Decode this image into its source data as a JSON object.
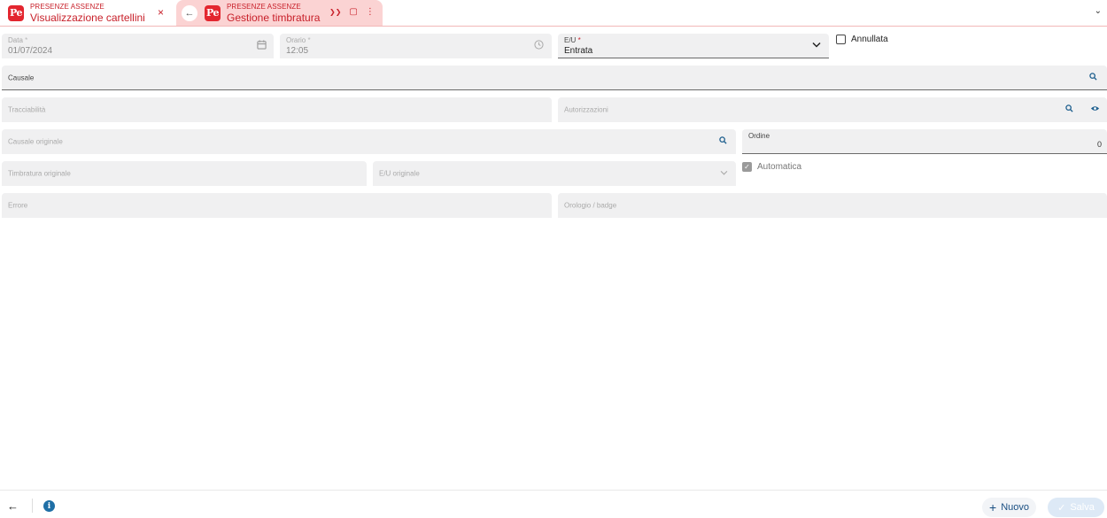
{
  "tabs": [
    {
      "app": "PRESENZE ASSENZE",
      "title": "Visualizzazione cartellini",
      "logo": "Pe",
      "close": "×"
    },
    {
      "app": "PRESENZE ASSENZE",
      "title": "Gestione timbratura",
      "logo": "Pe",
      "back": "←",
      "actions": [
        "❯❯",
        "▢",
        "⋮"
      ]
    }
  ],
  "tabbar_chevron": "⌄",
  "form": {
    "data": {
      "label": "Data",
      "required": "*",
      "value": "01/07/2024",
      "icon": "calendar-icon"
    },
    "orario": {
      "label": "Orario",
      "required": "*",
      "value": "12:05",
      "icon": "clock-icon"
    },
    "eu": {
      "label": "E/U",
      "required": "*",
      "value": "Entrata",
      "icon": "chevron-down-icon"
    },
    "annullata": {
      "label": "Annullata",
      "checked": false
    },
    "causale": {
      "placeholder": "Causale"
    },
    "tracciabilita": {
      "placeholder": "Tracciabilità"
    },
    "autorizzazioni": {
      "placeholder": "Autorizzazioni"
    },
    "causale_originale": {
      "placeholder": "Causale originale"
    },
    "ordine": {
      "label": "Ordine",
      "value": "0"
    },
    "timbratura_originale": {
      "placeholder": "Timbratura originale"
    },
    "eu_originale": {
      "placeholder": "E/U originale"
    },
    "automatica": {
      "label": "Automatica",
      "checked": true
    },
    "errore": {
      "placeholder": "Errore"
    },
    "orologio": {
      "placeholder": "Orologio / badge"
    }
  },
  "footer": {
    "back": "←",
    "info": "i",
    "nuovo": {
      "icon": "+",
      "label": "Nuovo"
    },
    "salva": {
      "icon": "✓",
      "label": "Salva"
    }
  },
  "colors": {
    "accent": "#c8202a",
    "logo_bg": "#e3262f",
    "tab_active_bg": "#fbd3d3",
    "link": "#1a4f82",
    "field_bg": "#f0f0f1"
  }
}
